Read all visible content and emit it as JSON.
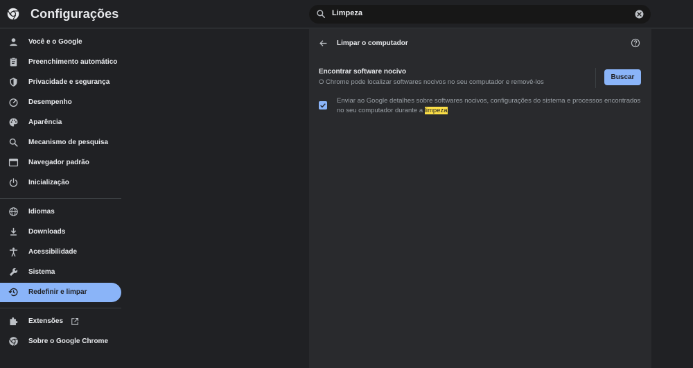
{
  "header": {
    "title": "Configurações"
  },
  "search": {
    "value": "Limpeza"
  },
  "sidebar": {
    "items": [
      {
        "label": "Você e o Google",
        "icon": "person-icon"
      },
      {
        "label": "Preenchimento automático",
        "icon": "clipboard-icon"
      },
      {
        "label": "Privacidade e segurança",
        "icon": "shield-icon"
      },
      {
        "label": "Desempenho",
        "icon": "speedometer-icon"
      },
      {
        "label": "Aparência",
        "icon": "palette-icon"
      },
      {
        "label": "Mecanismo de pesquisa",
        "icon": "search-icon"
      },
      {
        "label": "Navegador padrão",
        "icon": "browser-icon"
      },
      {
        "label": "Inicialização",
        "icon": "power-icon"
      },
      {
        "label": "Idiomas",
        "icon": "globe-icon"
      },
      {
        "label": "Downloads",
        "icon": "download-icon"
      },
      {
        "label": "Acessibilidade",
        "icon": "accessibility-icon"
      },
      {
        "label": "Sistema",
        "icon": "wrench-icon"
      },
      {
        "label": "Redefinir e limpar",
        "icon": "history-icon",
        "active": true
      },
      {
        "label": "Extensões",
        "icon": "puzzle-icon"
      },
      {
        "label": "Sobre o Google Chrome",
        "icon": "chrome-icon"
      }
    ]
  },
  "panel": {
    "title": "Limpar o computador",
    "row_title": "Encontrar software nocivo",
    "row_subtitle": "O Chrome pode localizar softwares nocivos no seu computador e removê-los",
    "button_label": "Buscar",
    "checkbox_text": "Enviar ao Google detalhes sobre softwares nocivos, configurações do sistema e processos encontrados no seu computador durante a ",
    "checkbox_highlight": "limpeza",
    "checkbox_checked": true
  },
  "colors": {
    "accent": "#8ab4f8",
    "highlight": "#fde047",
    "background": "#202124",
    "panel": "#292a2d"
  }
}
